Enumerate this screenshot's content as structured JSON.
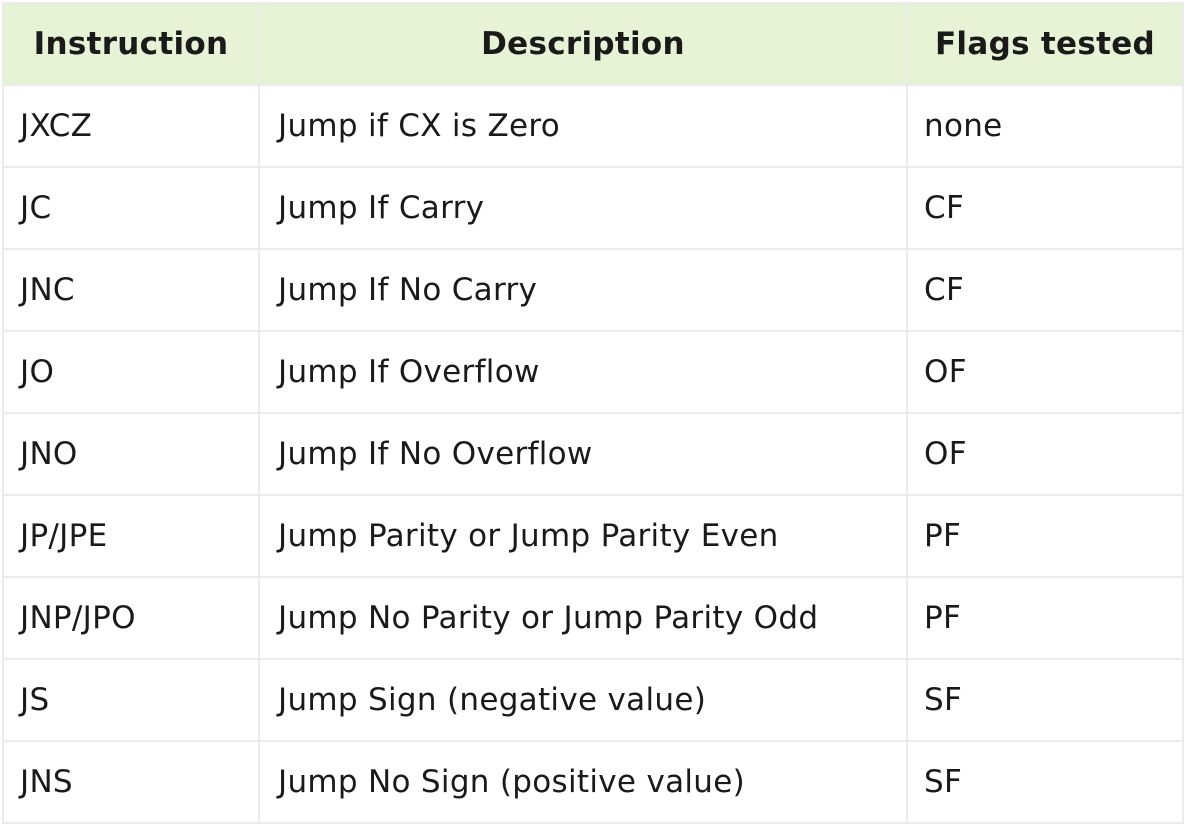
{
  "table": {
    "headers": {
      "instruction": "Instruction",
      "description": "Description",
      "flags": "Flags tested"
    },
    "rows": [
      {
        "instruction": "JXCZ",
        "description": "Jump if CX is Zero",
        "flags": "none"
      },
      {
        "instruction": "JC",
        "description": "Jump If Carry",
        "flags": "CF"
      },
      {
        "instruction": "JNC",
        "description": "Jump If No Carry",
        "flags": "CF"
      },
      {
        "instruction": "JO",
        "description": "Jump If Overflow",
        "flags": "OF"
      },
      {
        "instruction": "JNO",
        "description": "Jump If No Overflow",
        "flags": "OF"
      },
      {
        "instruction": "JP/JPE",
        "description": "Jump Parity or Jump Parity Even",
        "flags": "PF"
      },
      {
        "instruction": "JNP/JPO",
        "description": "Jump No Parity or Jump Parity Odd",
        "flags": "PF"
      },
      {
        "instruction": "JS",
        "description": "Jump Sign (negative value)",
        "flags": "SF"
      },
      {
        "instruction": "JNS",
        "description": "Jump No Sign (positive value)",
        "flags": "SF"
      }
    ]
  },
  "colors": {
    "header_background": "#e6f3d5",
    "border": "#ebebeb",
    "text": "#1a1a1a"
  }
}
